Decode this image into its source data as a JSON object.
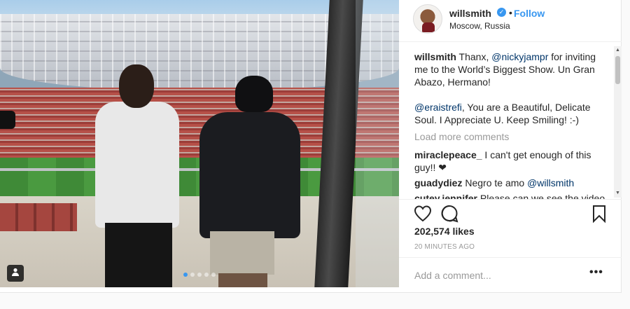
{
  "header": {
    "username": "willsmith",
    "verified_icon": "verified-badge-icon",
    "separator": "•",
    "follow_label": "Follow",
    "location": "Moscow, Russia"
  },
  "caption": {
    "username": "willsmith",
    "text_1": " Thanx, ",
    "mention_1": "@nickyjampr",
    "text_2": " for inviting me to the World’s Biggest Show. Un Gran Abazo, Hermano!",
    "mention_2": "@eraistrefi",
    "text_3": ", You are a Beautiful, Delicate Soul. I Appreciate U. Keep Smiling! :-)"
  },
  "load_more": "Load more comments",
  "comments": [
    {
      "user": "miraclepeace_",
      "text": " I can't get enough of this guy!! ❤"
    },
    {
      "user": "guadydiez",
      "text": " Negro te amo ",
      "mention": "@willsmith"
    },
    {
      "user": "cutey.jennifer",
      "text": " Please can we see the video"
    }
  ],
  "likes": "202,574 likes",
  "timestamp": "20 MINUTES AGO",
  "add_comment_placeholder": "Add a comment...",
  "more_options": "•••",
  "carousel": {
    "count": 5,
    "active_index": 0
  },
  "colors": {
    "accent": "#3897f0",
    "text": "#262626",
    "muted": "#999999"
  }
}
